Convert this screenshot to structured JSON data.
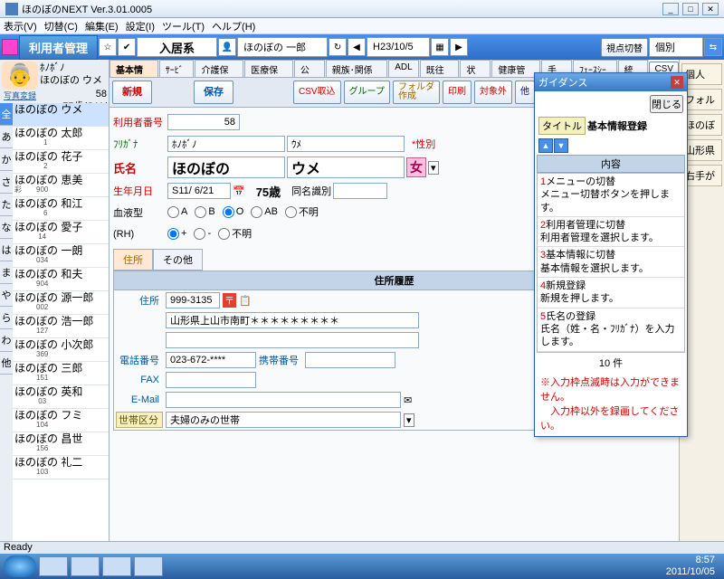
{
  "window": {
    "title": "ほのぼのNEXT  Ver.3.01.0005"
  },
  "menus": [
    "表示(V)",
    "切替(C)",
    "編集(E)",
    "設定(I)",
    "ツール(T)",
    "ヘルプ(H)"
  ],
  "toolbar": {
    "main_title": "利用者管理",
    "mode": "入居系",
    "username": "ほのぼの 一郎",
    "date": "H23/10/5",
    "view_switch": "視点切替",
    "level": "個別"
  },
  "profile": {
    "kana": "ﾎﾉﾎﾞﾉ",
    "name": "ほのぼの ウメ",
    "id": "58",
    "age_line": "75歳(S11/ 6/21)",
    "photo_reg": "写真変録"
  },
  "lefttabs": [
    "全",
    "あ",
    "か",
    "さ",
    "た",
    "な",
    "は",
    "ま",
    "や",
    "ら",
    "わ",
    "他"
  ],
  "patients": [
    {
      "name": "ほのぼの ウメ",
      "meta": "",
      "sel": true
    },
    {
      "name": "ほのぼの 太郎",
      "meta": "　　　　1"
    },
    {
      "name": "ほのぼの 花子",
      "meta": "　　　　2"
    },
    {
      "name": "ほのぼの 恵美",
      "meta": "彩　　900"
    },
    {
      "name": "ほのぼの 和江",
      "meta": "　　　　6"
    },
    {
      "name": "ほのぼの 愛子",
      "meta": "　　　 14"
    },
    {
      "name": "ほのぼの 一朗",
      "meta": "　　　034"
    },
    {
      "name": "ほのぼの 和夫",
      "meta": "　　　904"
    },
    {
      "name": "ほのぼの 源一郎",
      "meta": "　　　002"
    },
    {
      "name": "ほのぼの 浩一郎",
      "meta": "　　　127"
    },
    {
      "name": "ほのぼの 小次郎",
      "meta": "　　　369"
    },
    {
      "name": "ほのぼの 三郎",
      "meta": "　　　151"
    },
    {
      "name": "ほのぼの 英和",
      "meta": "　　　 03"
    },
    {
      "name": "ほのぼの フミ",
      "meta": "　　　104"
    },
    {
      "name": "ほのぼの 昌世",
      "meta": "　　　156"
    },
    {
      "name": "ほのぼの 礼二",
      "meta": "　　　103"
    }
  ],
  "tabs": [
    "基本情報",
    "ｻｰﾋﾞｽ",
    "介護保険",
    "医療保険",
    "公費",
    "親族･関係者",
    "ADL",
    "既往歴",
    "状況",
    "健康管理",
    "手帳",
    "ﾌｪｰｽｼｰﾄ",
    "統計"
  ],
  "csv_btn": "CSV",
  "actions": {
    "new": "新規",
    "save": "保存",
    "csv_imp": "CSV取込",
    "group": "グループ",
    "folder": "フォルダ\n作成",
    "print": "印刷",
    "exclude": "対象外",
    "other": "他"
  },
  "form": {
    "id_label": "利用者番号",
    "id": "58",
    "furi_label": "ﾌﾘｶﾞﾅ",
    "furi_sei": "ﾎﾉﾎﾞﾉ",
    "furi_mei": "ｳﾒ",
    "sex_label": "*性別",
    "name_label": "氏名",
    "sei": "ほのぼの",
    "mei": "ウメ",
    "sex": "女",
    "birth_label": "生年月日",
    "birth": "S11/ 6/21",
    "age": "75歳",
    "same_label": "同名識別",
    "same": "",
    "blood_label": "血液型",
    "blood_opts": [
      "A",
      "B",
      "O",
      "AB",
      "不明"
    ],
    "rh_label": "(RH)",
    "rh_opts": [
      "+",
      "-",
      "不明"
    ]
  },
  "subtabs": [
    "住所",
    "その他"
  ],
  "addr": {
    "header": "住所履歴",
    "addr_label": "住所",
    "zip": "999-3135",
    "line1": "山形県上山市南町＊＊＊＊＊＊＊＊＊",
    "tel_label": "電話番号",
    "tel": "023-672-****",
    "mob_label": "携帯番号",
    "mob": "",
    "fax_label": "FAX",
    "fax": "",
    "email_label": "E-Mail",
    "email": "",
    "setai_label": "世帯区分",
    "setai": "夫婦のみの世帯"
  },
  "rightcol": {
    "a": "個人",
    "b": "フォル",
    "c": "ほのぼ",
    "d": "山形県",
    "e": "右手が"
  },
  "guide": {
    "hdr": "ガイダンス",
    "close": "閉じる",
    "title_label": "タイトル",
    "title": "基本情報登録",
    "section": "内容",
    "items": [
      {
        "n": "1",
        "h": "メニューの切替",
        "b": "メニュー切替ボタンを押します。"
      },
      {
        "n": "2",
        "h": "利用者管理に切替",
        "b": "利用者管理を選択します。"
      },
      {
        "n": "3",
        "h": "基本情報に切替",
        "b": "基本情報を選択します。"
      },
      {
        "n": "4",
        "h": "新規登録",
        "b": "新規を押します。"
      },
      {
        "n": "5",
        "h": "氏名の登録",
        "b": "氏名（姓・名・ﾌﾘｶﾞﾅ）を入力します。"
      }
    ],
    "count": "10 件",
    "warn1": "※入力枠点滅時は入力ができません。",
    "warn2": "　入力枠以外を録画してください。"
  },
  "status": "Ready",
  "clock": {
    "time": "8:57",
    "date": "2011/10/05"
  }
}
